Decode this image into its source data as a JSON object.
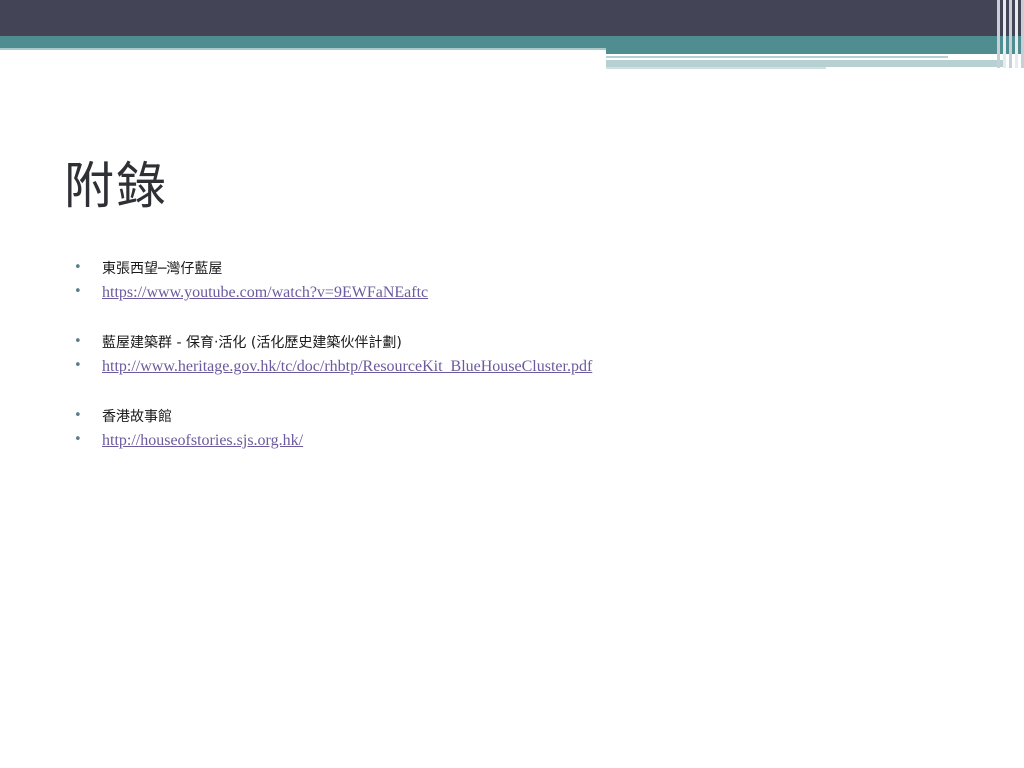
{
  "slide": {
    "title": "附錄",
    "bullet_symbol": "•",
    "items": [
      {
        "type": "text",
        "text": "東張西望─灣仔藍屋"
      },
      {
        "type": "link",
        "text": "https://www.youtube.com/watch?v=9EWFaNEaftc"
      },
      {
        "type": "text",
        "text": "藍屋建築群 - 保育‧活化 (活化歷史建築伙伴計劃)"
      },
      {
        "type": "link",
        "text": "http://www.heritage.gov.hk/tc/doc/rhbtp/ResourceKit_BlueHouseCluster.pdf"
      },
      {
        "type": "text",
        "text": "香港故事館"
      },
      {
        "type": "link",
        "text": "http://houseofstories.sjs.org.hk/"
      }
    ]
  },
  "colors": {
    "header_dark": "#434456",
    "header_teal": "#4f8d91",
    "link": "#6b5a9e",
    "bullet": "#5b7f88"
  }
}
